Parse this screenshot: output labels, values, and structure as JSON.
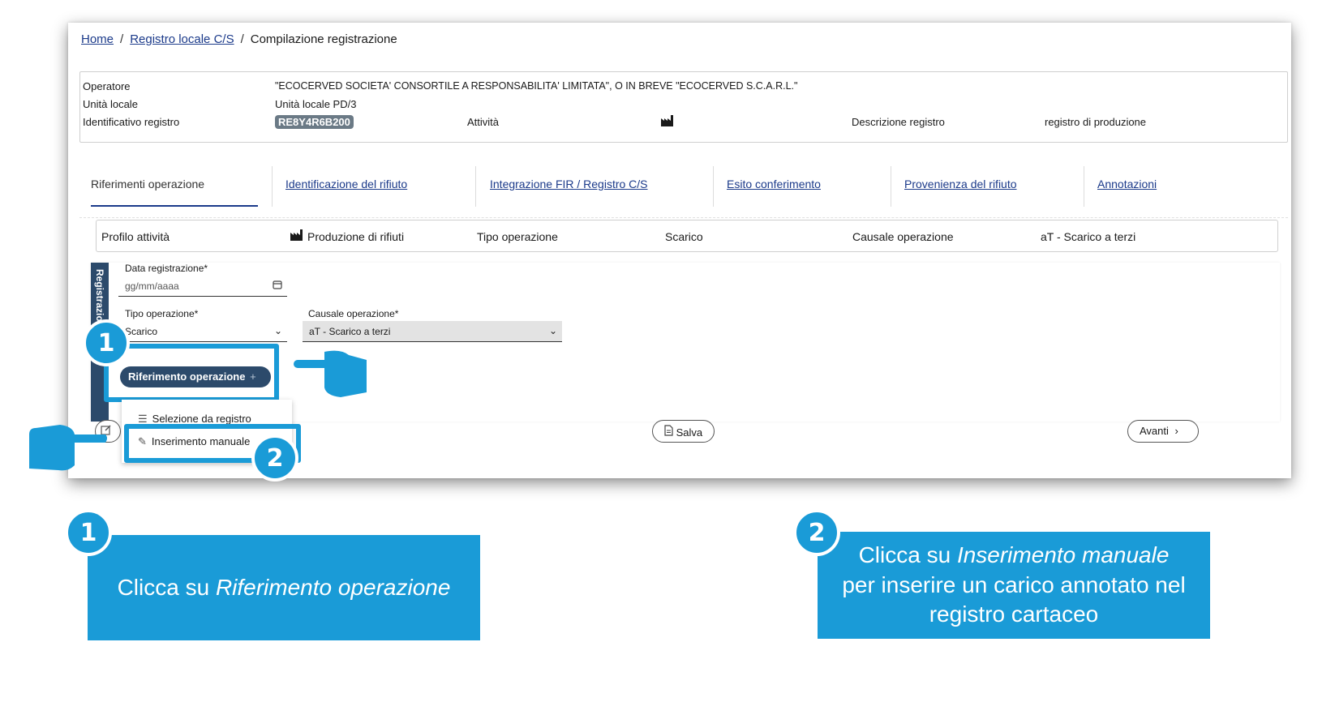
{
  "breadcrumb": {
    "home": "Home",
    "registro": "Registro locale C/S",
    "current": "Compilazione registrazione",
    "sep": "/"
  },
  "operator": {
    "operatore_label": "Operatore",
    "operatore_value": "\"ECOCERVED SOCIETA' CONSORTILE A RESPONSABILITA' LIMITATA\", O IN BREVE \"ECOCERVED S.C.A.R.L.\"",
    "unita_label": "Unità locale",
    "unita_value": "Unità locale PD/3",
    "id_label": "Identificativo registro",
    "id_value": "RE8Y4R6B200",
    "attivita_label": "Attività",
    "descr_label": "Descrizione registro",
    "descr_value": "registro di produzione"
  },
  "tabs": [
    {
      "label": "Riferimenti operazione"
    },
    {
      "label": "Identificazione del rifiuto"
    },
    {
      "label": "Integrazione FIR / Registro C/S"
    },
    {
      "label": "Esito conferimento"
    },
    {
      "label": "Provenienza del rifiuto"
    },
    {
      "label": "Annotazioni"
    }
  ],
  "profile": {
    "profilo_label": "Profilo attività",
    "profilo_value": "Produzione di rifiuti",
    "tipo_label": "Tipo operazione",
    "tipo_value": "Scarico",
    "causale_label": "Causale operazione",
    "causale_value": "aT - Scarico a terzi"
  },
  "form": {
    "section_label": "Registrazione",
    "data_label": "Data registrazione*",
    "data_placeholder": "gg/mm/aaaa",
    "tipo_label": "Tipo operazione*",
    "tipo_value": "Scarico",
    "causale_label": "Causale operazione*",
    "causale_value": "aT - Scarico a terzi",
    "rif_button": "Riferimento operazione",
    "rif_plus": "+"
  },
  "dropdown": {
    "item1": "Selezione da registro",
    "item2": "Inserimento manuale"
  },
  "footer": {
    "salva": "Salva",
    "avanti": "Avanti"
  },
  "callouts": {
    "num1": "1",
    "num2": "2",
    "cap1_prefix": "Clicca su ",
    "cap1_em": "Riferimento operazione",
    "cap2_prefix": "Clicca su ",
    "cap2_em": "Inserimento manuale",
    "cap2_rest1": "per inserire un carico annotato nel",
    "cap2_rest2": "registro cartaceo"
  },
  "colors": {
    "accent": "#1a9bd7",
    "navy": "#2c4a6b",
    "link": "#1b3a8a"
  }
}
